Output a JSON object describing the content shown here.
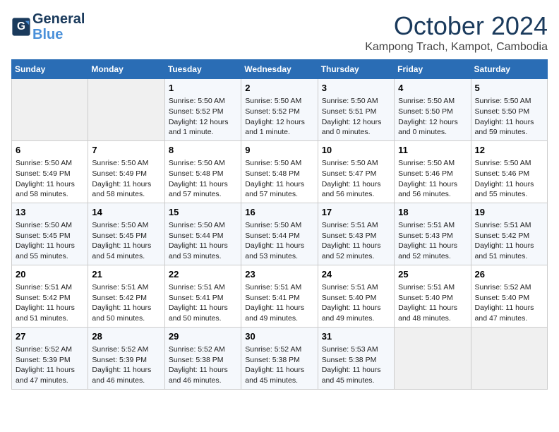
{
  "header": {
    "logo_line1": "General",
    "logo_line2": "Blue",
    "month": "October 2024",
    "location": "Kampong Trach, Kampot, Cambodia"
  },
  "weekdays": [
    "Sunday",
    "Monday",
    "Tuesday",
    "Wednesday",
    "Thursday",
    "Friday",
    "Saturday"
  ],
  "weeks": [
    [
      {
        "day": "",
        "info": ""
      },
      {
        "day": "",
        "info": ""
      },
      {
        "day": "1",
        "info": "Sunrise: 5:50 AM\nSunset: 5:52 PM\nDaylight: 12 hours and 1 minute."
      },
      {
        "day": "2",
        "info": "Sunrise: 5:50 AM\nSunset: 5:52 PM\nDaylight: 12 hours and 1 minute."
      },
      {
        "day": "3",
        "info": "Sunrise: 5:50 AM\nSunset: 5:51 PM\nDaylight: 12 hours and 0 minutes."
      },
      {
        "day": "4",
        "info": "Sunrise: 5:50 AM\nSunset: 5:50 PM\nDaylight: 12 hours and 0 minutes."
      },
      {
        "day": "5",
        "info": "Sunrise: 5:50 AM\nSunset: 5:50 PM\nDaylight: 11 hours and 59 minutes."
      }
    ],
    [
      {
        "day": "6",
        "info": "Sunrise: 5:50 AM\nSunset: 5:49 PM\nDaylight: 11 hours and 58 minutes."
      },
      {
        "day": "7",
        "info": "Sunrise: 5:50 AM\nSunset: 5:49 PM\nDaylight: 11 hours and 58 minutes."
      },
      {
        "day": "8",
        "info": "Sunrise: 5:50 AM\nSunset: 5:48 PM\nDaylight: 11 hours and 57 minutes."
      },
      {
        "day": "9",
        "info": "Sunrise: 5:50 AM\nSunset: 5:48 PM\nDaylight: 11 hours and 57 minutes."
      },
      {
        "day": "10",
        "info": "Sunrise: 5:50 AM\nSunset: 5:47 PM\nDaylight: 11 hours and 56 minutes."
      },
      {
        "day": "11",
        "info": "Sunrise: 5:50 AM\nSunset: 5:46 PM\nDaylight: 11 hours and 56 minutes."
      },
      {
        "day": "12",
        "info": "Sunrise: 5:50 AM\nSunset: 5:46 PM\nDaylight: 11 hours and 55 minutes."
      }
    ],
    [
      {
        "day": "13",
        "info": "Sunrise: 5:50 AM\nSunset: 5:45 PM\nDaylight: 11 hours and 55 minutes."
      },
      {
        "day": "14",
        "info": "Sunrise: 5:50 AM\nSunset: 5:45 PM\nDaylight: 11 hours and 54 minutes."
      },
      {
        "day": "15",
        "info": "Sunrise: 5:50 AM\nSunset: 5:44 PM\nDaylight: 11 hours and 53 minutes."
      },
      {
        "day": "16",
        "info": "Sunrise: 5:50 AM\nSunset: 5:44 PM\nDaylight: 11 hours and 53 minutes."
      },
      {
        "day": "17",
        "info": "Sunrise: 5:51 AM\nSunset: 5:43 PM\nDaylight: 11 hours and 52 minutes."
      },
      {
        "day": "18",
        "info": "Sunrise: 5:51 AM\nSunset: 5:43 PM\nDaylight: 11 hours and 52 minutes."
      },
      {
        "day": "19",
        "info": "Sunrise: 5:51 AM\nSunset: 5:42 PM\nDaylight: 11 hours and 51 minutes."
      }
    ],
    [
      {
        "day": "20",
        "info": "Sunrise: 5:51 AM\nSunset: 5:42 PM\nDaylight: 11 hours and 51 minutes."
      },
      {
        "day": "21",
        "info": "Sunrise: 5:51 AM\nSunset: 5:42 PM\nDaylight: 11 hours and 50 minutes."
      },
      {
        "day": "22",
        "info": "Sunrise: 5:51 AM\nSunset: 5:41 PM\nDaylight: 11 hours and 50 minutes."
      },
      {
        "day": "23",
        "info": "Sunrise: 5:51 AM\nSunset: 5:41 PM\nDaylight: 11 hours and 49 minutes."
      },
      {
        "day": "24",
        "info": "Sunrise: 5:51 AM\nSunset: 5:40 PM\nDaylight: 11 hours and 49 minutes."
      },
      {
        "day": "25",
        "info": "Sunrise: 5:51 AM\nSunset: 5:40 PM\nDaylight: 11 hours and 48 minutes."
      },
      {
        "day": "26",
        "info": "Sunrise: 5:52 AM\nSunset: 5:40 PM\nDaylight: 11 hours and 47 minutes."
      }
    ],
    [
      {
        "day": "27",
        "info": "Sunrise: 5:52 AM\nSunset: 5:39 PM\nDaylight: 11 hours and 47 minutes."
      },
      {
        "day": "28",
        "info": "Sunrise: 5:52 AM\nSunset: 5:39 PM\nDaylight: 11 hours and 46 minutes."
      },
      {
        "day": "29",
        "info": "Sunrise: 5:52 AM\nSunset: 5:38 PM\nDaylight: 11 hours and 46 minutes."
      },
      {
        "day": "30",
        "info": "Sunrise: 5:52 AM\nSunset: 5:38 PM\nDaylight: 11 hours and 45 minutes."
      },
      {
        "day": "31",
        "info": "Sunrise: 5:53 AM\nSunset: 5:38 PM\nDaylight: 11 hours and 45 minutes."
      },
      {
        "day": "",
        "info": ""
      },
      {
        "day": "",
        "info": ""
      }
    ]
  ]
}
